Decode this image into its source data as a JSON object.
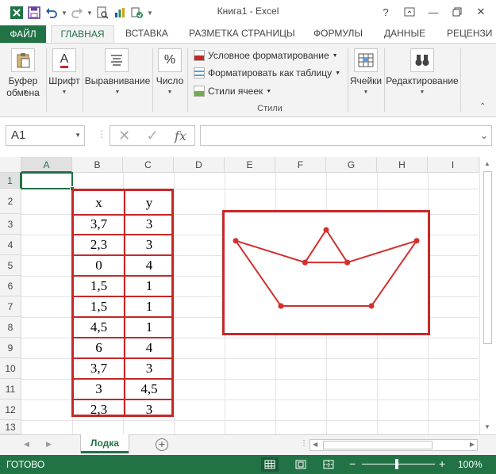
{
  "window": {
    "title": "Книга1 - Excel",
    "help": "?",
    "minimize": "—",
    "close": "✕"
  },
  "ribbon_tabs": [
    "ФАЙЛ",
    "ГЛАВНАЯ",
    "ВСТАВКА",
    "РАЗМЕТКА СТРАНИЦЫ",
    "ФОРМУЛЫ",
    "ДАННЫЕ",
    "РЕЦЕНЗИ"
  ],
  "ribbon": {
    "clipboard": "Буфер обмена",
    "font": "Шрифт",
    "alignment": "Выравнивание",
    "number": "Число",
    "cond_format": "Условное форматирование",
    "format_table": "Форматировать как таблицу",
    "cell_styles": "Стили ячеек",
    "styles_caption": "Стили",
    "cells": "Ячейки",
    "editing": "Редактирование",
    "font_icon_letter": "A",
    "number_icon": "%"
  },
  "formula_bar": {
    "name_box": "A1",
    "fx": "fx",
    "value": ""
  },
  "columns": [
    "A",
    "B",
    "C",
    "D",
    "E",
    "F",
    "G",
    "H",
    "I"
  ],
  "rows": [
    "1",
    "2",
    "3",
    "4",
    "5",
    "6",
    "7",
    "8",
    "9",
    "10",
    "11",
    "12",
    "13"
  ],
  "table": {
    "headers": [
      "x",
      "y"
    ],
    "rows": [
      [
        "3,7",
        "3"
      ],
      [
        "2,3",
        "3"
      ],
      [
        "0",
        "4"
      ],
      [
        "1,5",
        "1"
      ],
      [
        "1,5",
        "1"
      ],
      [
        "4,5",
        "1"
      ],
      [
        "6",
        "4"
      ],
      [
        "3,7",
        "3"
      ],
      [
        "3",
        "4,5"
      ],
      [
        "2,3",
        "3"
      ]
    ],
    "border_color": "#c62828"
  },
  "chart_data": {
    "type": "scatter",
    "series": [
      {
        "x": [
          3.7,
          2.3,
          0,
          1.5,
          1.5,
          4.5,
          6,
          3.7,
          3,
          2.3
        ],
        "y": [
          3,
          3,
          4,
          1,
          1,
          1,
          4,
          3,
          4.5,
          3
        ],
        "color": "#d32f2f"
      }
    ],
    "xlim": [
      0,
      6
    ],
    "ylim": [
      1,
      4.5
    ],
    "grid": false,
    "title": "",
    "xlabel": "",
    "ylabel": ""
  },
  "sheet": {
    "active_tab": "Лодка",
    "add": "+"
  },
  "status": {
    "ready": "ГОТОВО",
    "zoom": "100%",
    "zoom_minus": "−",
    "zoom_plus": "+"
  },
  "colors": {
    "accent": "#217346",
    "chart_line": "#d32f2f"
  }
}
